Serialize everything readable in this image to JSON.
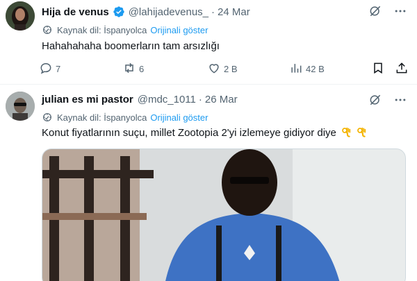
{
  "tweets": [
    {
      "name": "Hija de venus",
      "verified": true,
      "handle": "@lahijadevenus_",
      "separator": "·",
      "date": "24 Mar",
      "translate_label": "Kaynak dil: İspanyolca",
      "show_original": "Orijinali göster",
      "text": "Hahahahaha boomerların tam arsızlığı",
      "actions": {
        "replies": "7",
        "reposts": "6",
        "likes": "2 B",
        "views": "42 B"
      }
    },
    {
      "name": "julian es mi pastor",
      "verified": false,
      "handle": "@mdc_1011",
      "separator": "·",
      "date": "26 Mar",
      "translate_label": "Kaynak dil: İspanyolca",
      "show_original": "Orijinali göster",
      "text": "Konut fiyatlarının suçu, millet Zootopia 2'yi izlemeye gidiyor diye",
      "emojis": [
        "ok-hand-emoji",
        "ok-hand-emoji"
      ]
    }
  ],
  "colors": {
    "accent": "#1d9bf0",
    "text": "#0f1419",
    "muted": "#536471",
    "divider": "#eff3f4"
  },
  "icons": [
    "verified-badge-icon",
    "grok-icon",
    "more-icon",
    "translate-icon",
    "reply-icon",
    "repost-icon",
    "like-icon",
    "views-icon",
    "bookmark-icon",
    "share-icon"
  ]
}
